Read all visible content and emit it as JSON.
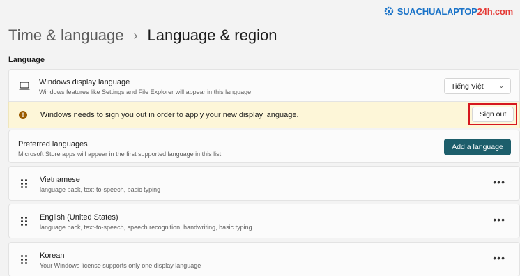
{
  "watermark": {
    "text_main": "SUACHUALAPTOP",
    "text_accent": "24h.com"
  },
  "header": {
    "parent": "Time & language",
    "separator": "›",
    "current": "Language & region"
  },
  "section": {
    "label": "Language"
  },
  "display_language": {
    "title": "Windows display language",
    "subtitle": "Windows features like Settings and File Explorer will appear in this language",
    "selected": "Tiếng Việt",
    "icon": "laptop-icon"
  },
  "warning": {
    "text": "Windows needs to sign you out in order to apply your new display language.",
    "button": "Sign out",
    "icon": "info-icon",
    "highlight_color": "#d6171e"
  },
  "preferred": {
    "title": "Preferred languages",
    "subtitle": "Microsoft Store apps will appear in the first supported language in this list",
    "button": "Add a language",
    "button_color": "#1d5e6b"
  },
  "languages": [
    {
      "name": "Vietnamese",
      "detail": "language pack, text-to-speech, basic typing"
    },
    {
      "name": "English (United States)",
      "detail": "language pack, text-to-speech, speech recognition, handwriting, basic typing"
    },
    {
      "name": "Korean",
      "detail": "Your Windows license supports only one display language"
    }
  ],
  "more_label": "•••"
}
